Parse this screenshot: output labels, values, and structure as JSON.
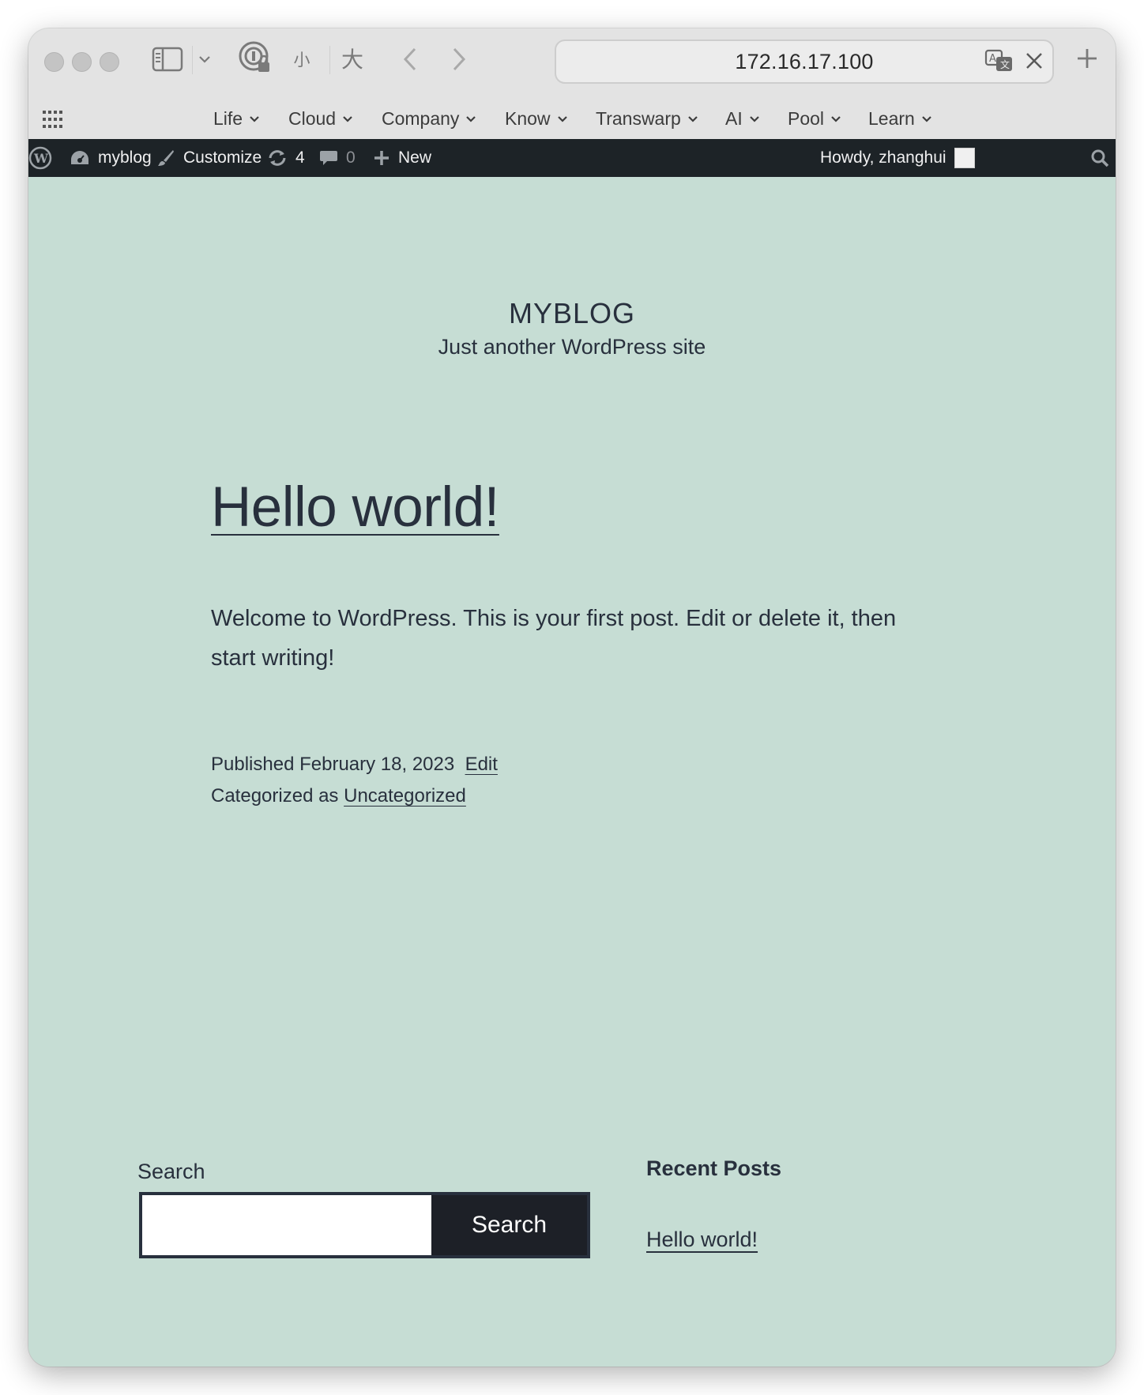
{
  "browser": {
    "address": "172.16.17.100",
    "bookmarks": [
      {
        "label": "Life"
      },
      {
        "label": "Cloud"
      },
      {
        "label": "Company"
      },
      {
        "label": "Know"
      },
      {
        "label": "Transwarp"
      },
      {
        "label": "AI"
      },
      {
        "label": "Pool"
      },
      {
        "label": "Learn"
      }
    ],
    "toolbar": {
      "font_small": "小",
      "font_large": "大"
    }
  },
  "adminbar": {
    "site": "myblog",
    "customize": "Customize",
    "updates_count": "4",
    "comments_count": "0",
    "new": "New",
    "howdy": "Howdy, zhanghui"
  },
  "site": {
    "title": "MYBLOG",
    "description": "Just another WordPress site"
  },
  "post": {
    "title": "Hello world!",
    "content": "Welcome to WordPress. This is your first post. Edit or delete it, then start writing!",
    "published_prefix": "Published",
    "published_date": "February 18, 2023",
    "edit": "Edit",
    "category_prefix": "Categorized as",
    "category": "Uncategorized"
  },
  "widgets": {
    "search_label": "Search",
    "search_value": "",
    "search_button": "Search",
    "recent_title": "Recent Posts",
    "recent_posts": [
      "Hello world!"
    ]
  },
  "colors": {
    "page_bg": "#c6ddd4",
    "adminbar_bg": "#1d2327",
    "text": "#28303d",
    "button_bg": "#1d2027"
  }
}
